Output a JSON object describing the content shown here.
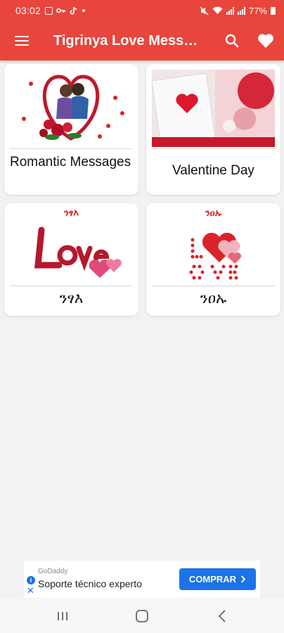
{
  "status_bar": {
    "time": "03:02",
    "battery": "77%"
  },
  "app_bar": {
    "title": "Tigrinya Love Messa...",
    "icons": [
      "menu-icon",
      "search-icon",
      "heart-icon"
    ]
  },
  "categories": [
    {
      "label": "Romantic Messages",
      "caption": ""
    },
    {
      "label": "Valentine Day",
      "caption": ""
    },
    {
      "label": "ንፃእ",
      "caption": "ንፃእ"
    },
    {
      "label": "ንዐኡ",
      "caption": "ንዐኡ"
    }
  ],
  "ad": {
    "brand": "GoDaddy",
    "text": "Soporte técnico experto",
    "cta": "COMPRAR"
  },
  "nav_bar": {
    "icons": [
      "recents-icon",
      "home-icon",
      "back-icon"
    ]
  },
  "colors": {
    "primary": "#e8453c",
    "accent_red": "#d9232a",
    "ad_blue": "#1a73e8"
  }
}
